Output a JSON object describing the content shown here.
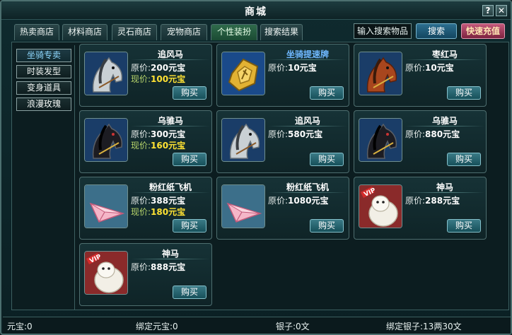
{
  "window": {
    "title": "商城"
  },
  "tabs": [
    {
      "label": "热卖商店"
    },
    {
      "label": "材料商店"
    },
    {
      "label": "灵石商店"
    },
    {
      "label": "宠物商店"
    },
    {
      "label": "个性装扮",
      "active": true
    },
    {
      "label": "搜索结果"
    }
  ],
  "search": {
    "placeholder": "输入搜索物品",
    "button_label": "搜索"
  },
  "recharge": {
    "label": "快速充值"
  },
  "sidebar": {
    "items": [
      {
        "label": "坐骑专卖",
        "active": true
      },
      {
        "label": "时装发型"
      },
      {
        "label": "变身道具"
      },
      {
        "label": "浪漫玫瑰"
      }
    ]
  },
  "items": [
    {
      "name": "追风马",
      "icon": "gray-horse-icon",
      "orig_label": "原价:",
      "orig_price": "200元宝",
      "sale_label": "现价:",
      "sale_price": "100元宝",
      "buy": "购买"
    },
    {
      "name": "坐骑提速牌",
      "icon": "gold-token-icon",
      "orig_label": "原价:",
      "orig_price": "10元宝",
      "buy": "购买"
    },
    {
      "name": "枣红马",
      "icon": "chestnut-horse-icon",
      "orig_label": "原价:",
      "orig_price": "10元宝",
      "buy": "购买"
    },
    {
      "name": "乌骓马",
      "icon": "black-horse-icon",
      "orig_label": "原价:",
      "orig_price": "300元宝",
      "sale_label": "现价:",
      "sale_price": "160元宝",
      "buy": "购买"
    },
    {
      "name": "追风马",
      "icon": "gray-horse-icon",
      "orig_label": "原价:",
      "orig_price": "580元宝",
      "buy": "购买"
    },
    {
      "name": "乌骓马",
      "icon": "black-horse-icon",
      "orig_label": "原价:",
      "orig_price": "880元宝",
      "buy": "购买"
    },
    {
      "name": "粉红纸飞机",
      "icon": "pink-paper-plane-icon",
      "orig_label": "原价:",
      "orig_price": "388元宝",
      "sale_label": "现价:",
      "sale_price": "180元宝",
      "buy": "购买"
    },
    {
      "name": "粉红纸飞机",
      "icon": "pink-paper-plane-icon",
      "orig_label": "原价:",
      "orig_price": "1080元宝",
      "buy": "购买"
    },
    {
      "name": "神马",
      "icon": "white-alpaca-vip-icon",
      "orig_label": "原价:",
      "orig_price": "288元宝",
      "buy": "购买",
      "vip": "VIP"
    },
    {
      "name": "神马",
      "icon": "white-alpaca-vip-icon",
      "orig_label": "原价:",
      "orig_price": "888元宝",
      "buy": "购买",
      "vip": "VIP"
    }
  ],
  "status": {
    "yuanbao": "元宝:0",
    "bound_yuanbao": "绑定元宝:0",
    "silver": "银子:0文",
    "bound_silver": "绑定银子:13两30文"
  },
  "colors": {
    "accent": "#2c6e8f",
    "recharge": "#c3587a",
    "sale_price": "#ffe233"
  }
}
